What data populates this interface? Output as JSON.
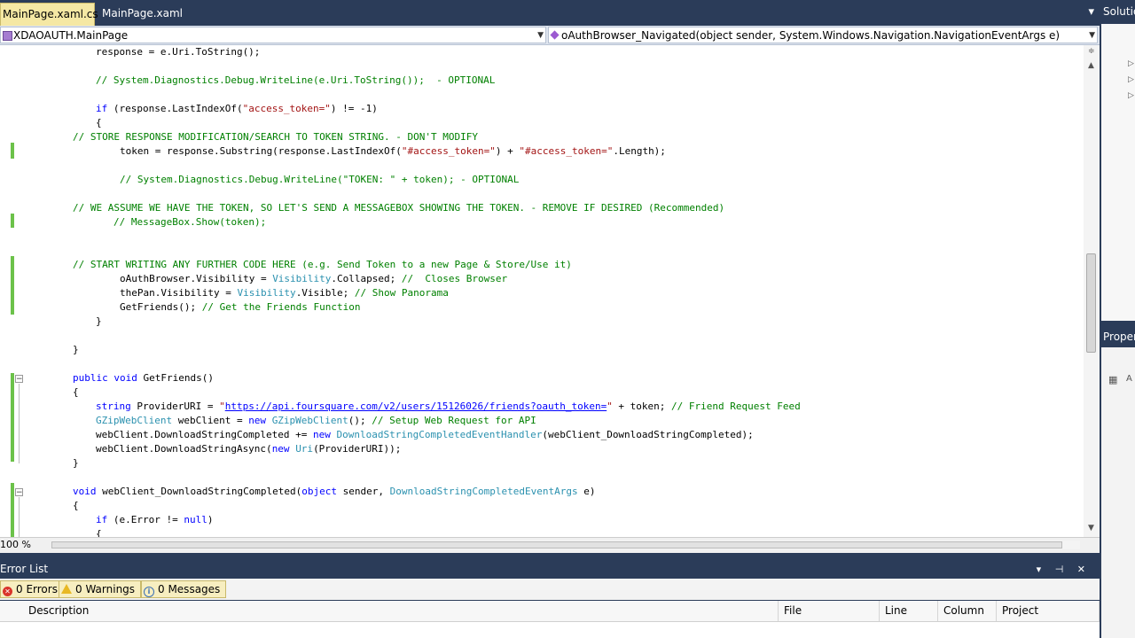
{
  "tabs": [
    {
      "label": "MainPage.xaml.cs",
      "active": true
    },
    {
      "label": "MainPage.xaml",
      "active": false
    }
  ],
  "nav": {
    "class_dropdown": "XDAOAUTH.MainPage",
    "member_dropdown": "oAuthBrowser_Navigated(object sender, System.Windows.Navigation.NavigationEventArgs e)"
  },
  "code_lines": [
    "response = e.Uri.ToString();",
    "// System.Diagnostics.Debug.WriteLine(e.Uri.ToString());  - OPTIONAL",
    "if (response.LastIndexOf(\"access_token=\") != -1)",
    "{",
    "// STORE RESPONSE MODIFICATION/SEARCH TO TOKEN STRING. - DON'T MODIFY",
    "token = response.Substring(response.LastIndexOf(\"#access_token=\") + \"#access_token=\".Length);",
    "// System.Diagnostics.Debug.WriteLine(\"TOKEN: \" + token); - OPTIONAL",
    "// WE ASSUME WE HAVE THE TOKEN, SO LET'S SEND A MESSAGEBOX SHOWING THE TOKEN. - REMOVE IF DESIRED (Recommended)",
    "// MessageBox.Show(token);",
    "// START WRITING ANY FURTHER CODE HERE (e.g. Send Token to a new Page & Store/Use it)",
    "oAuthBrowser.Visibility = Visibility.Collapsed; //  Closes Browser",
    "thePan.Visibility = Visibility.Visible; // Show Panorama",
    "GetFriends(); // Get the Friends Function",
    "}",
    "}",
    "public void GetFriends()",
    "{",
    "string ProviderURI = \"https://api.foursquare.com/v2/users/15126026/friends?oauth_token=\" + token; // Friend Request Feed",
    "GZipWebClient webClient = new GZipWebClient(); // Setup Web Request for API",
    "webClient.DownloadStringCompleted += new DownloadStringCompletedEventHandler(webClient_DownloadStringCompleted);",
    "webClient.DownloadStringAsync(new Uri(ProviderURI));",
    "}",
    "void webClient_DownloadStringCompleted(object sender, DownloadStringCompletedEventArgs e)",
    "{",
    "if (e.Error != null)",
    "{"
  ],
  "zoom": "100 %",
  "error_list": {
    "title": "Error List",
    "errors": "0 Errors",
    "warnings": "0 Warnings",
    "messages": "0 Messages",
    "columns": [
      "Description",
      "File",
      "Line",
      "Column",
      "Project"
    ]
  },
  "right_panel": {
    "solution_title": "Solutio",
    "properties_title": "Proper"
  }
}
